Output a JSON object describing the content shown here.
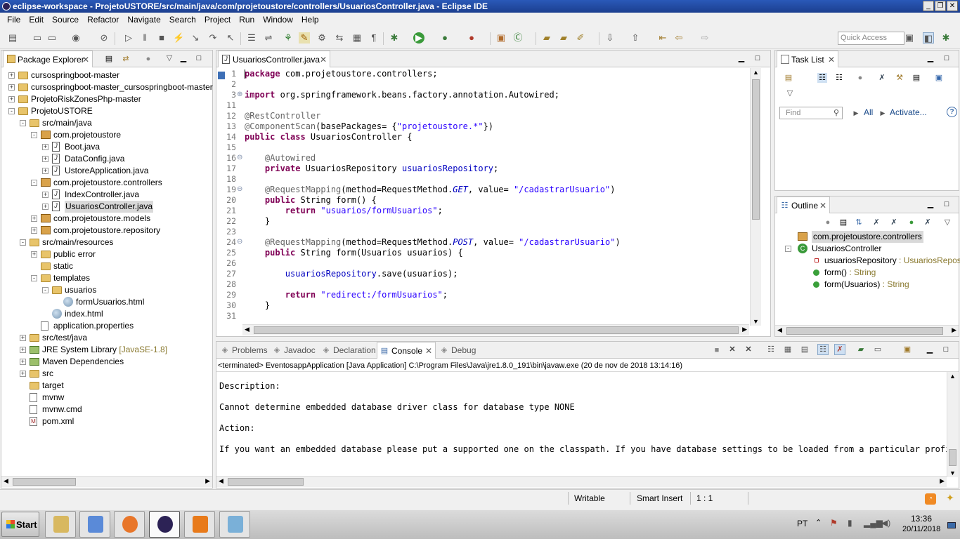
{
  "window": {
    "title": "eclipse-workspace - ProjetoUSTORE/src/main/java/com/projetoustore/controllers/UsuariosController.java - Eclipse IDE",
    "minimize": "_",
    "restore": "❐",
    "close": "✕"
  },
  "menu": [
    "File",
    "Edit",
    "Source",
    "Refactor",
    "Navigate",
    "Search",
    "Project",
    "Run",
    "Window",
    "Help"
  ],
  "quick_access": {
    "placeholder": "Quick Access"
  },
  "package_explorer": {
    "tab_label": "Package Explorer",
    "tree": [
      {
        "label": "cursospringboot-master",
        "indent": 0,
        "icon": "project-folder-icon",
        "expander": "+"
      },
      {
        "label": "cursospringboot-master_cursospringboot-master",
        "indent": 0,
        "icon": "project-folder-icon",
        "expander": "+"
      },
      {
        "label": "ProjetoRiskZonesPhp-master",
        "indent": 0,
        "icon": "project-folder-icon",
        "expander": "+"
      },
      {
        "label": "ProjetoUSTORE",
        "indent": 0,
        "icon": "project-folder-icon",
        "expander": "-"
      },
      {
        "label": "src/main/java",
        "indent": 1,
        "icon": "source-folder-icon",
        "expander": "-"
      },
      {
        "label": "com.projetoustore",
        "indent": 2,
        "icon": "package-icon",
        "expander": "-"
      },
      {
        "label": "Boot.java",
        "indent": 3,
        "icon": "java-file-icon",
        "expander": "+"
      },
      {
        "label": "DataConfig.java",
        "indent": 3,
        "icon": "java-file-icon",
        "expander": "+"
      },
      {
        "label": "UstoreApplication.java",
        "indent": 3,
        "icon": "java-file-icon",
        "expander": "+"
      },
      {
        "label": "com.projetoustore.controllers",
        "indent": 2,
        "icon": "package-icon",
        "expander": "-"
      },
      {
        "label": "IndexController.java",
        "indent": 3,
        "icon": "java-file-icon",
        "expander": "+"
      },
      {
        "label": "UsuariosController.java",
        "indent": 3,
        "icon": "java-file-icon",
        "expander": "+",
        "selected": true
      },
      {
        "label": "com.projetoustore.models",
        "indent": 2,
        "icon": "package-icon",
        "expander": "+"
      },
      {
        "label": "com.projetoustore.repository",
        "indent": 2,
        "icon": "package-icon",
        "expander": "+"
      },
      {
        "label": "src/main/resources",
        "indent": 1,
        "icon": "source-folder-icon",
        "expander": "-"
      },
      {
        "label": "public error",
        "indent": 2,
        "icon": "folder-icon",
        "expander": "+"
      },
      {
        "label": "static",
        "indent": 2,
        "icon": "folder-icon",
        "expander": ""
      },
      {
        "label": "templates",
        "indent": 2,
        "icon": "folder-icon",
        "expander": "-"
      },
      {
        "label": "usuarios",
        "indent": 3,
        "icon": "folder-icon",
        "expander": "-"
      },
      {
        "label": "formUsuarios.html",
        "indent": 4,
        "icon": "html-file-icon",
        "expander": ""
      },
      {
        "label": "index.html",
        "indent": 3,
        "icon": "html-file-icon",
        "expander": ""
      },
      {
        "label": "application.properties",
        "indent": 2,
        "icon": "properties-file-icon",
        "expander": ""
      },
      {
        "label": "src/test/java",
        "indent": 1,
        "icon": "source-folder-icon",
        "expander": "+"
      },
      {
        "label": "JRE System Library",
        "suffix": " [JavaSE-1.8]",
        "indent": 1,
        "icon": "library-icon",
        "expander": "+"
      },
      {
        "label": "Maven Dependencies",
        "indent": 1,
        "icon": "library-icon",
        "expander": "+"
      },
      {
        "label": "src",
        "indent": 1,
        "icon": "folder-icon",
        "expander": "+"
      },
      {
        "label": "target",
        "indent": 1,
        "icon": "folder-icon",
        "expander": ""
      },
      {
        "label": "mvnw",
        "indent": 1,
        "icon": "file-icon",
        "expander": ""
      },
      {
        "label": "mvnw.cmd",
        "indent": 1,
        "icon": "file-icon",
        "expander": ""
      },
      {
        "label": "pom.xml",
        "indent": 1,
        "icon": "xml-file-icon",
        "expander": ""
      }
    ]
  },
  "editor": {
    "tab_label": "UsuariosController.java",
    "lines": [
      {
        "n": "1",
        "html": "<span class=\"kw\">package</span> com.projetoustore.controllers;"
      },
      {
        "n": "2",
        "html": ""
      },
      {
        "n": "3",
        "html": "<span class=\"kw\">import</span> org.springframework.beans.factory.annotation.Autowired;",
        "fold": "+"
      },
      {
        "n": "11",
        "html": ""
      },
      {
        "n": "12",
        "html": "<span class=\"ann\">@RestController</span>"
      },
      {
        "n": "13",
        "html": "<span class=\"ann\">@ComponentScan</span>(basePackages= {<span class=\"str\">\"projetoustore.*\"</span>})"
      },
      {
        "n": "14",
        "html": "<span class=\"kw\">public class</span> UsuariosController {"
      },
      {
        "n": "15",
        "html": ""
      },
      {
        "n": "16",
        "html": "    <span class=\"ann\">@Autowired</span>",
        "fold": "-"
      },
      {
        "n": "17",
        "html": "    <span class=\"kw\">private</span> UsuariosRepository <span class=\"fld\">usuariosRepository</span>;"
      },
      {
        "n": "18",
        "html": ""
      },
      {
        "n": "19",
        "html": "    <span class=\"ann\">@RequestMapping</span>(method=RequestMethod.<span class=\"ital\">GET</span>, value= <span class=\"str\">\"/cadastrarUsuario\"</span>)",
        "fold": "-"
      },
      {
        "n": "20",
        "html": "    <span class=\"kw\">public</span> String form() {"
      },
      {
        "n": "21",
        "html": "        <span class=\"kw\">return</span> <span class=\"str\">\"usuarios/formUsuarios\"</span>;"
      },
      {
        "n": "22",
        "html": "    }"
      },
      {
        "n": "23",
        "html": ""
      },
      {
        "n": "24",
        "html": "    <span class=\"ann\">@RequestMapping</span>(method=RequestMethod.<span class=\"ital\">POST</span>, value= <span class=\"str\">\"/cadastrarUsuario\"</span>)",
        "fold": "-"
      },
      {
        "n": "25",
        "html": "    <span class=\"kw\">public</span> String form(Usuarios usuarios) {"
      },
      {
        "n": "26",
        "html": ""
      },
      {
        "n": "27",
        "html": "        <span class=\"fld\">usuariosRepository</span>.save(usuarios);"
      },
      {
        "n": "28",
        "html": ""
      },
      {
        "n": "29",
        "html": "        <span class=\"kw\">return</span> <span class=\"str\">\"redirect:/formUsuarios\"</span>;"
      },
      {
        "n": "30",
        "html": "    }"
      },
      {
        "n": "31",
        "html": ""
      }
    ]
  },
  "task_list": {
    "tab_label": "Task List",
    "find_placeholder": "Find",
    "all_label": "All",
    "activate_label": "Activate..."
  },
  "outline": {
    "tab_label": "Outline",
    "items": [
      {
        "label": "com.projetoustore.controllers",
        "icon": "package-icon",
        "selected": true
      },
      {
        "label": "UsuariosController",
        "icon": "class-icon"
      },
      {
        "label": "usuariosRepository",
        "suffix": " : UsuariosRepositor",
        "icon": "private-field-icon"
      },
      {
        "label": "form()",
        "suffix": " : String",
        "icon": "public-method-icon"
      },
      {
        "label": "form(Usuarios)",
        "suffix": " : String",
        "icon": "public-method-icon"
      }
    ]
  },
  "bottom_tabs": [
    {
      "label": "Problems",
      "icon": "problems-icon"
    },
    {
      "label": "Javadoc",
      "icon": "javadoc-icon"
    },
    {
      "label": "Declaration",
      "icon": "declaration-icon"
    },
    {
      "label": "Console",
      "icon": "console-icon",
      "active": true
    },
    {
      "label": "Debug",
      "icon": "debug-icon"
    }
  ],
  "console": {
    "header": "<terminated> EventosappApplication [Java Application] C:\\Program Files\\Java\\jre1.8.0_191\\bin\\javaw.exe (20 de nov de 2018 13:14:16)",
    "lines": [
      "Description:",
      "",
      "Cannot determine embedded database driver class for database type NONE",
      "",
      "Action:",
      "",
      "If you want an embedded database please put a supported one on the classpath. If you have database settings to be loaded from a particular profile y"
    ]
  },
  "status": {
    "writable": "Writable",
    "insert_mode": "Smart Insert",
    "position": "1 : 1"
  },
  "taskbar": {
    "start_label": "Start",
    "language": "PT",
    "time": "13:36",
    "date": "20/11/2018",
    "apps": [
      "file-explorer-icon",
      "media-player-icon",
      "firefox-like-icon",
      "eclipse-icon",
      "sublime-icon",
      "paint-icon"
    ]
  }
}
